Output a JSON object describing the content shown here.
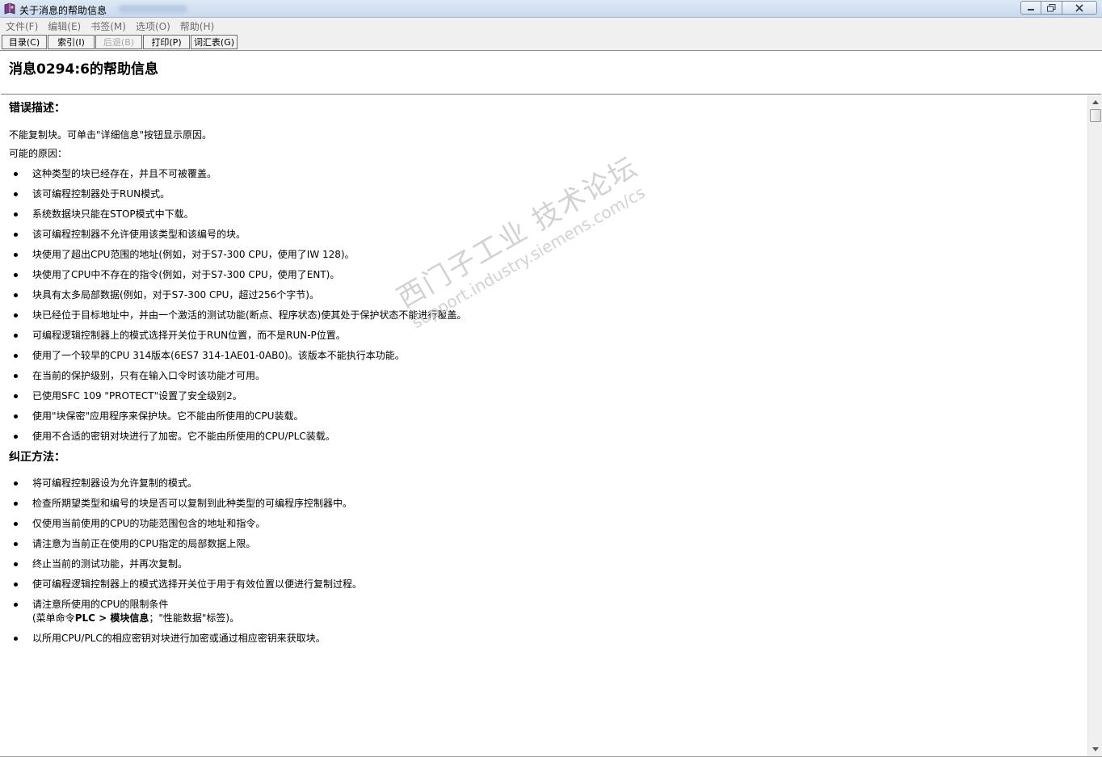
{
  "window": {
    "title": "关于消息的帮助信息",
    "minimize_label": "—",
    "maximize_label": "❐",
    "close_label": "✕"
  },
  "menu": [
    "文件(F)",
    "编辑(E)",
    "书签(M)",
    "选项(O)",
    "帮助(H)"
  ],
  "toolbar": [
    {
      "label": "目录(C)",
      "enabled": true
    },
    {
      "label": "索引(I)",
      "enabled": true
    },
    {
      "label": "后退(B)",
      "enabled": false
    },
    {
      "label": "打印(P)",
      "enabled": true
    },
    {
      "label": "词汇表(G)",
      "enabled": true
    }
  ],
  "topic": {
    "title": "消息0294:6的帮助信息"
  },
  "error_section": {
    "heading": "错误描述：",
    "intro": "不能复制块。可单击\"详细信息\"按钮显示原因。",
    "causes_label": "可能的原因：",
    "items": [
      "这种类型的块已经存在，并且不可被覆盖。",
      "该可编程控制器处于RUN模式。",
      "系统数据块只能在STOP模式中下载。",
      "该可编程控制器不允许使用该类型和该编号的块。",
      "块使用了超出CPU范围的地址(例如，对于S7-300 CPU，使用了IW 128)。",
      "块使用了CPU中不存在的指令(例如，对于S7-300 CPU，使用了ENT)。",
      "块具有太多局部数据(例如，对于S7-300 CPU，超过256个字节)。",
      "块已经位于目标地址中，并由一个激活的测试功能(断点、程序状态)使其处于保护状态不能进行覆盖。",
      "可编程逻辑控制器上的模式选择开关位于RUN位置，而不是RUN-P位置。",
      "使用了一个较早的CPU 314版本(6ES7 314-1AE01-0AB0)。该版本不能执行本功能。",
      "在当前的保护级别，只有在输入口令时该功能才可用。",
      "已使用SFC 109 \"PROTECT\"设置了安全级别2。",
      "使用\"块保密\"应用程序来保护块。它不能由所使用的CPU装载。",
      "使用不合适的密钥对块进行了加密。它不能由所使用的CPU/PLC装载。"
    ]
  },
  "fix_section": {
    "heading": "纠正方法：",
    "items": [
      "将可编程控制器设为允许复制的模式。",
      "检查所期望类型和编号的块是否可以复制到此种类型的可编程序控制器中。",
      "仅使用当前使用的CPU的功能范围包含的地址和指令。",
      "请注意为当前正在使用的CPU指定的局部数据上限。",
      "终止当前的测试功能，并再次复制。",
      "使可编程逻辑控制器上的模式选择开关位于用于有效位置以便进行复制过程。"
    ],
    "limits_item": {
      "line1": "请注意所使用的CPU的限制条件",
      "line2_prefix": "(菜单命令",
      "line2_bold1": "PLC > ",
      "line2_bold2": "模块信息",
      "line2_suffix": "；\"性能数据\"标签)。"
    },
    "last_item": "以所用CPU/PLC的相应密钥对块进行加密或通过相应密钥来获取块。"
  },
  "watermark": {
    "text": "西门子工业 技术论坛",
    "url": "support.industry.siemens.com/cs"
  }
}
